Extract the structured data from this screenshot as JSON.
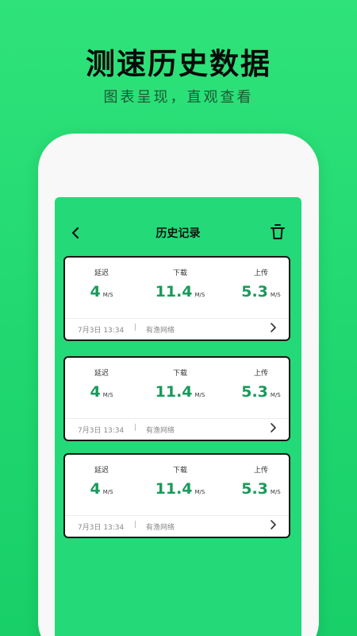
{
  "banner": {
    "title": "测速历史数据",
    "subtitle": "图表呈现，直观查看"
  },
  "nav": {
    "title": "历史记录",
    "back_icon": "chevron-left-icon",
    "delete_icon": "trash-icon"
  },
  "records": [
    {
      "latency_label": "延迟",
      "latency_value": "4",
      "latency_unit": "M/S",
      "download_label": "下载",
      "download_value": "11.4",
      "download_unit": "M/S",
      "upload_label": "上传",
      "upload_value": "5.3",
      "upload_unit": "M/S",
      "time": "7月3日 13:34",
      "separator": "|",
      "network": "有渔网络"
    },
    {
      "latency_label": "延迟",
      "latency_value": "4",
      "latency_unit": "M/S",
      "download_label": "下载",
      "download_value": "11.4",
      "download_unit": "M/S",
      "upload_label": "上传",
      "upload_value": "5.3",
      "upload_unit": "M/S",
      "time": "7月3日 13:34",
      "separator": "|",
      "network": "有渔网络"
    },
    {
      "latency_label": "延迟",
      "latency_value": "4",
      "latency_unit": "M/S",
      "download_label": "下载",
      "download_value": "11.4",
      "download_unit": "M/S",
      "upload_label": "上传",
      "upload_value": "5.3",
      "upload_unit": "M/S",
      "time": "7月3日 13:34",
      "separator": "|",
      "network": "有渔网络"
    }
  ],
  "colors": {
    "background": "#1fd66f",
    "screen": "#24d977",
    "value": "#179b5a"
  }
}
